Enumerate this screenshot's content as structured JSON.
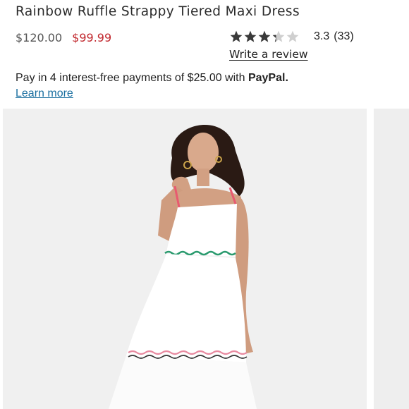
{
  "product": {
    "title": "Rainbow Ruffle Strappy Tiered Maxi Dress",
    "price_original": "$120.00",
    "price_sale": "$99.99"
  },
  "rating": {
    "value": "3.3",
    "count": "(33)",
    "stars_filled": 3.3,
    "stars_total": 5,
    "write_review_label": "Write a review"
  },
  "payment": {
    "pay_text": "Pay in 4 interest-free payments of $25.00 with ",
    "brand": "PayPal.",
    "learn_more_label": "Learn more"
  },
  "colors": {
    "sale_price": "#c1272d",
    "link": "#1a6fa0",
    "star": "#3a3a3a",
    "star_empty": "#cfcfcf"
  }
}
